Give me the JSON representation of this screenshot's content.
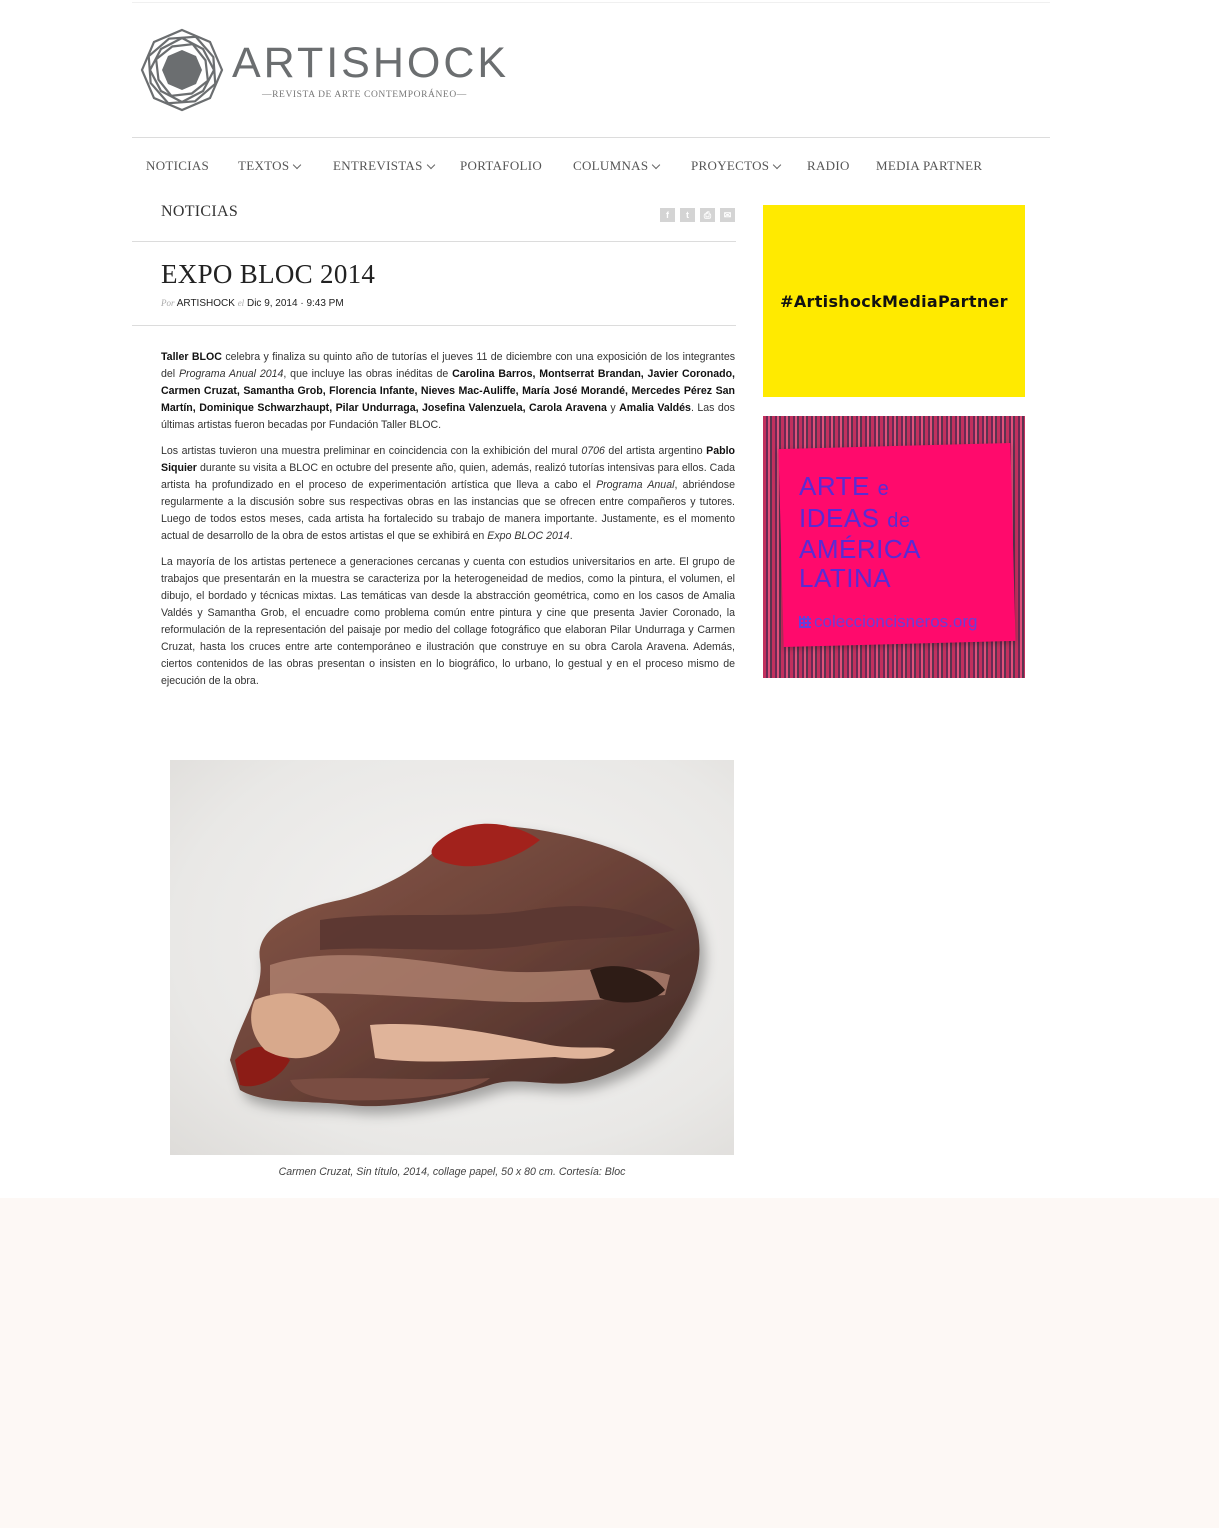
{
  "site": {
    "name": "ARTISHOCK",
    "tagline": "—REVISTA DE ARTE CONTEMPORÁNEO—"
  },
  "nav": {
    "items": [
      {
        "label": "NOTICIAS",
        "dropdown": false
      },
      {
        "label": "TEXTOS",
        "dropdown": true
      },
      {
        "label": "ENTREVISTAS",
        "dropdown": true
      },
      {
        "label": "PORTAFOLIO",
        "dropdown": false
      },
      {
        "label": "COLUMNAS",
        "dropdown": true
      },
      {
        "label": "PROYECTOS",
        "dropdown": true
      },
      {
        "label": "RADIO",
        "dropdown": false
      },
      {
        "label": "MEDIA PARTNER",
        "dropdown": false
      }
    ]
  },
  "section": {
    "label": "NOTICIAS"
  },
  "share": {
    "icons": [
      "facebook-icon",
      "twitter-icon",
      "print-icon",
      "email-icon"
    ],
    "glyphs": [
      "f",
      "t",
      "⎙",
      "✉"
    ]
  },
  "article": {
    "title": "EXPO BLOC 2014",
    "meta": {
      "by": "Por",
      "author": "ARTISHOCK",
      "sep": "el",
      "date": "Dic 9, 2014 · 9:43 PM"
    },
    "caption": "Carmen Cruzat, Sin título, 2014, collage papel, 50 x 80 cm. Cortesía: Bloc"
  },
  "ads": {
    "media_partner": {
      "text": "#ArtishockMediaPartner",
      "color": "#ffea00"
    },
    "cisneros": {
      "line1": "ARTE",
      "line1b": "e",
      "line2": "IDEAS",
      "line2b": "de",
      "line3": "AMÉRICA",
      "line4": "LATINA",
      "url": "coleccioncisneros.org",
      "color": "#ff0a6c"
    }
  },
  "colors": {
    "page_bg": "#ffffff",
    "outer_bg": "#fdf8f5",
    "logo_gray": "#6b6e70"
  }
}
